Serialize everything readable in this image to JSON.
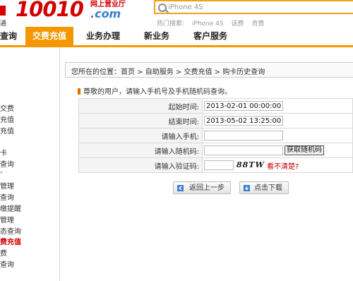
{
  "header": {
    "logo_left_sub": "通",
    "logo_main": "10010",
    "logo_cn": "网上营业厅",
    "logo_com": ".com",
    "search_value": "iPhone 4S",
    "hot_search_label": "热门搜索:",
    "hot_search_items": [
      "iPhone 4S",
      "话费",
      "资费"
    ]
  },
  "nav": {
    "items": [
      "查询",
      "交费充值",
      "业务办理",
      "新业务",
      "客户服务"
    ],
    "active": "交费充值"
  },
  "sidebar": {
    "items": [
      "交费",
      "充值",
      "充值",
      "卡",
      "查询",
      "-",
      "管理",
      "查询",
      "缴提醒",
      "管理",
      "态查询",
      "费充值",
      "费",
      "查询"
    ]
  },
  "breadcrumb": "您所在的位置：首页 > 自助服务 > 交费充值 > 购卡历史查询",
  "notice": "尊敬的用户，请输入手机号及手机随机码查询。",
  "form": {
    "start_label": "起始时间:",
    "start_value": "2013-02-01 00:00:00",
    "end_label": "结束时间:",
    "end_value": "2013-05-02 13:25:00",
    "phone_label": "请输入手机:",
    "phone_value": "",
    "random_label": "请输入随机码:",
    "random_value": "",
    "random_button": "获取随机码",
    "captcha_label": "请输入验证码:",
    "captcha_value": "",
    "captcha_text": "88TW",
    "unclear_link": "看不清楚?"
  },
  "actions": {
    "back": "返回上一步",
    "download": "点击下载"
  },
  "colors": {
    "brand_red": "#d40000",
    "nav_orange": "#f39800",
    "com_blue": "#3a7fd0"
  }
}
